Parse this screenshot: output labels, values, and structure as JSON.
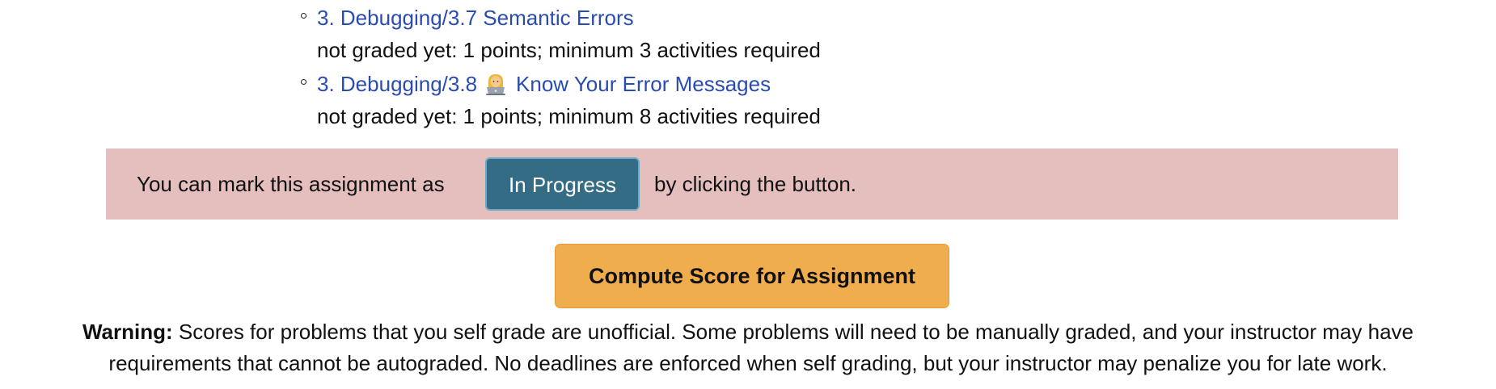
{
  "activities": [
    {
      "link_text": "3. Debugging/3.7 Semantic Errors",
      "status": "not graded yet: 1 points; minimum 3 activities required"
    },
    {
      "link_prefix": "3. Debugging/3.8",
      "link_icon": "technologist-emoji-icon",
      "link_suffix": "Know Your Error Messages",
      "status": "not graded yet: 1 points; minimum 8 activities required"
    }
  ],
  "status_banner": {
    "text_before": "You can mark this assignment as",
    "button_label": "In Progress",
    "text_after": "by clicking the button.",
    "background_color": "#e4bfbe",
    "button_color": "#356c85"
  },
  "compute_button": {
    "label": "Compute Score for Assignment",
    "color": "#f0ad4e"
  },
  "warning": {
    "label": "Warning:",
    "line1": "Scores for problems that you self grade are unofficial. Some problems will need to be manually graded, and your instructor may have",
    "line2": "requirements that cannot be autograded. No deadlines are enforced when self grading, but your instructor may penalize you for late work."
  },
  "colors": {
    "link": "#2a4cb0"
  }
}
